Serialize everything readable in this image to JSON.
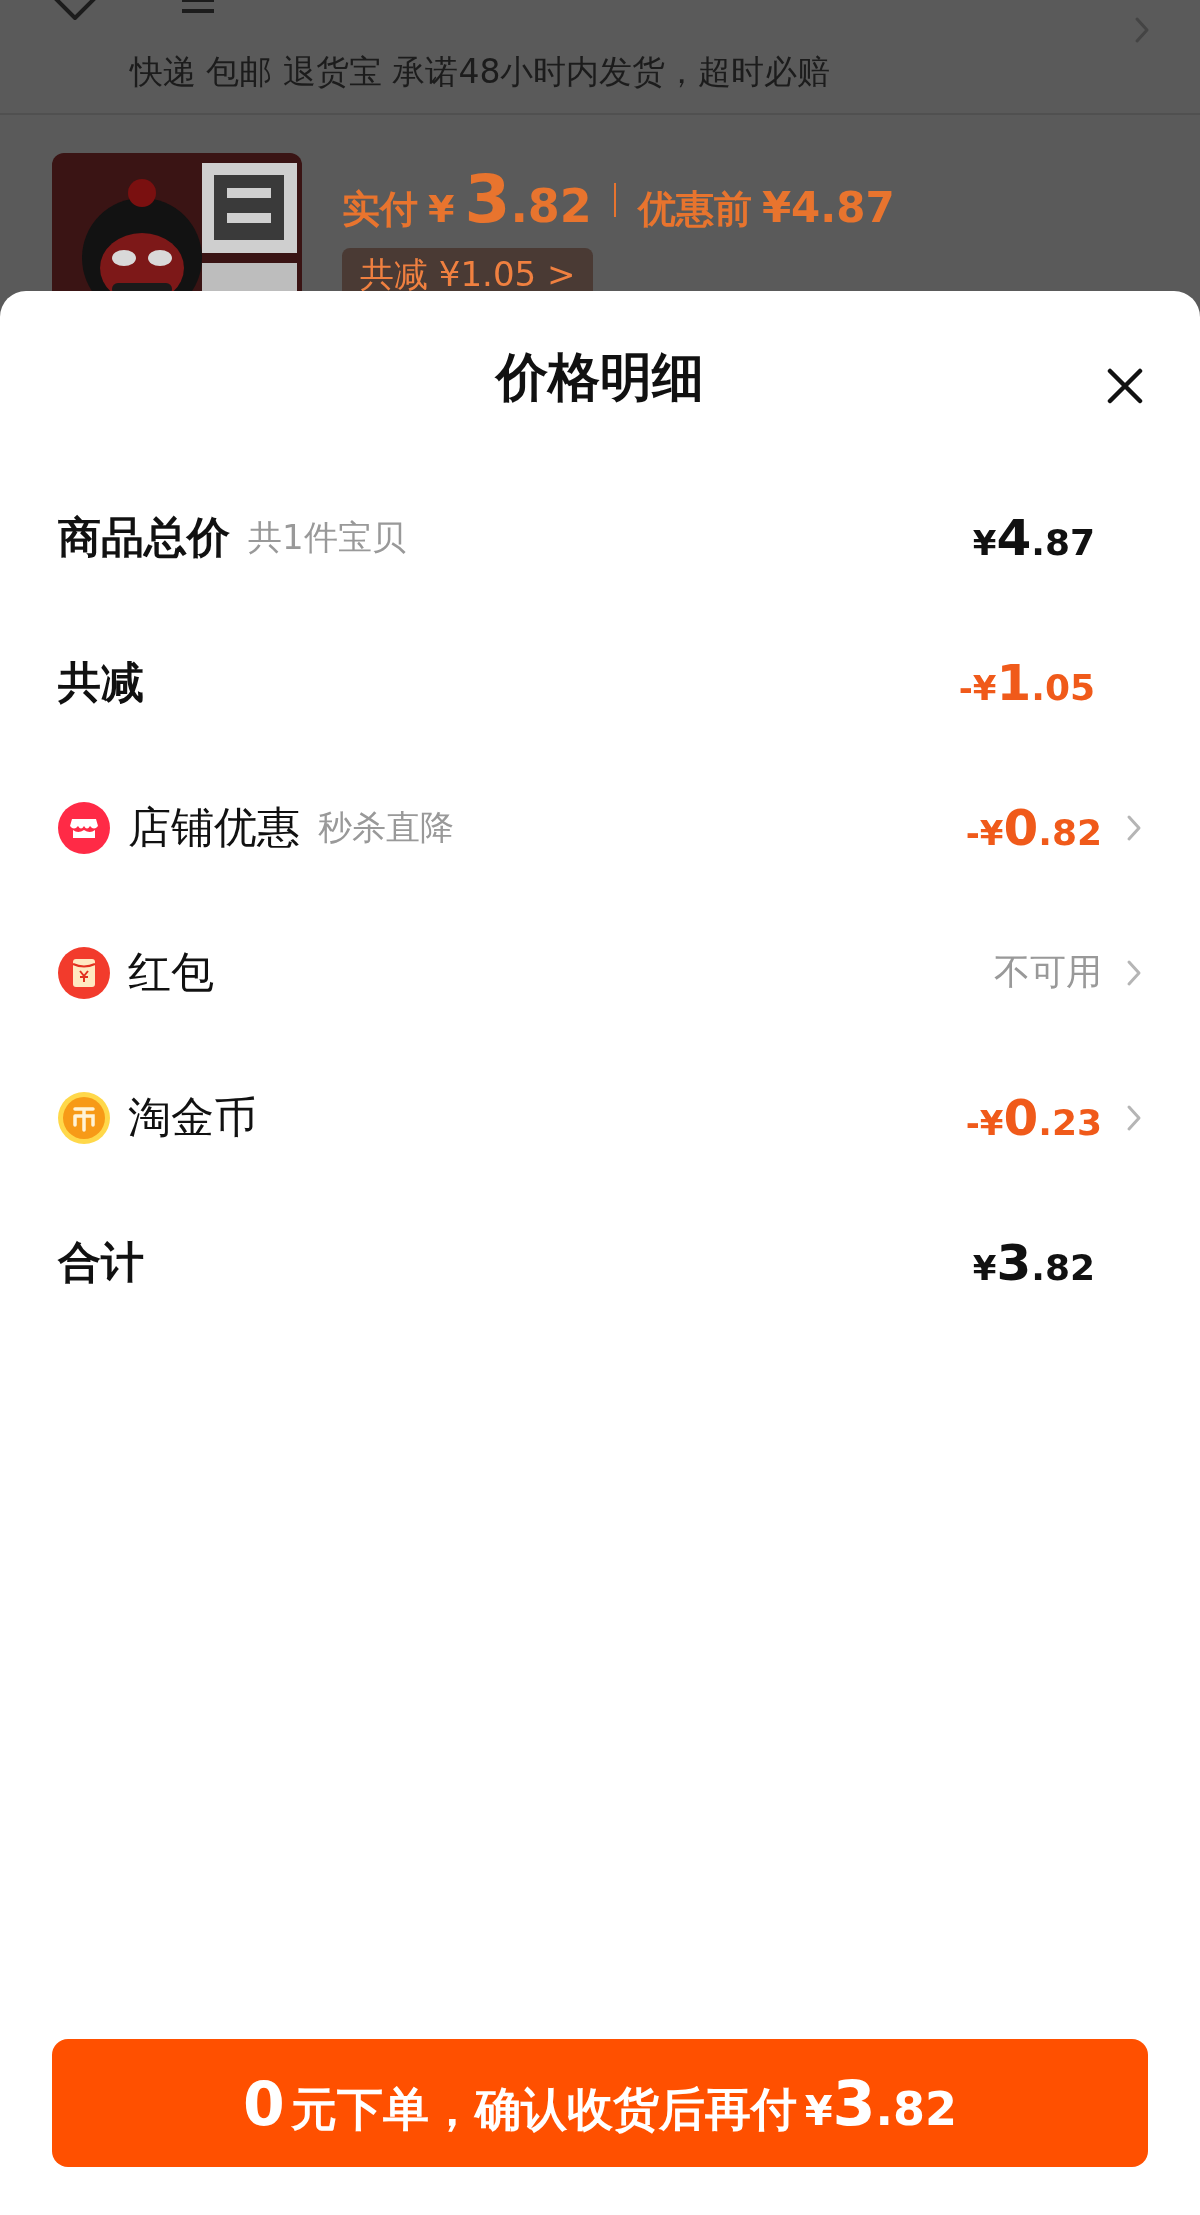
{
  "background_page": {
    "service_line": "快递 包邮 退货宝 承诺48小时内发货，超时必赔",
    "product": {
      "kind": "picture",
      "paid_label": "实付",
      "paid_currency": "¥",
      "paid_integer": "3",
      "paid_fraction": ".82",
      "original_label": "优惠前",
      "original_price": "¥4.87",
      "discount_tag": "共减 ¥1.05 >"
    }
  },
  "sheet": {
    "title": "价格明细",
    "rows": [
      {
        "kind": "summary",
        "label": "商品总价",
        "note": "共1件宝贝",
        "amount": {
          "prefix": "¥",
          "integer": "4",
          "fraction": ".87",
          "color": "#111111"
        }
      },
      {
        "kind": "summary",
        "label": "共减",
        "amount": {
          "prefix": "-¥",
          "integer": "1",
          "fraction": ".05",
          "color": "#f05a1a"
        }
      },
      {
        "kind": "benefit",
        "label": "店铺优惠",
        "note": "秒杀直降",
        "amount": {
          "prefix": "-¥",
          "integer": "0",
          "fraction": ".82",
          "color": "#f05a1a"
        }
      },
      {
        "kind": "benefit",
        "label": "红包",
        "status": "不可用"
      },
      {
        "kind": "benefit",
        "label": "淘金币",
        "amount": {
          "prefix": "-¥",
          "integer": "0",
          "fraction": ".23",
          "color": "#f05a1a"
        }
      },
      {
        "kind": "summary",
        "label": "合计",
        "amount": {
          "prefix": "¥",
          "integer": "3",
          "fraction": ".82",
          "color": "#111111"
        }
      }
    ],
    "button": {
      "lead": "0",
      "text": "元下单，确认收货后再付",
      "currency": "¥",
      "integer": "3",
      "fraction": ".82"
    }
  }
}
